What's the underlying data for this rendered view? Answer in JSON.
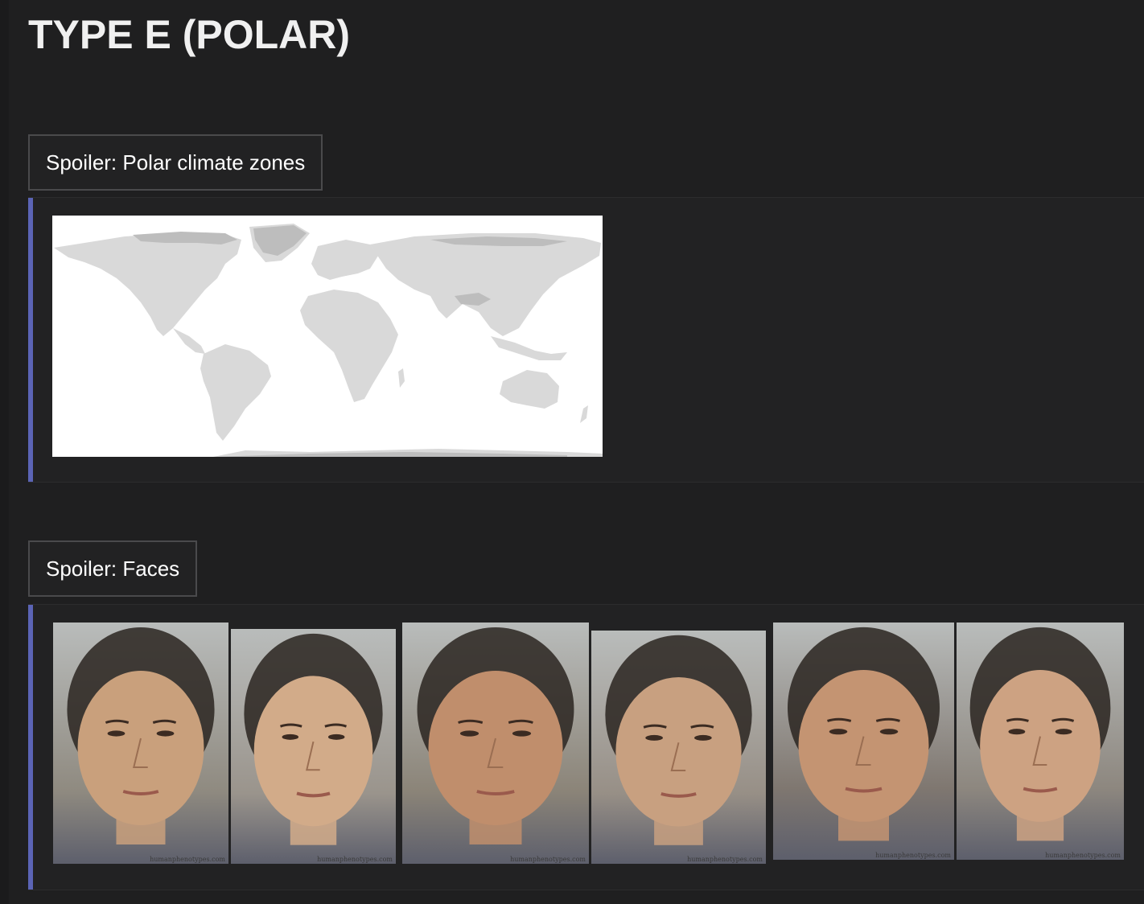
{
  "page": {
    "title": "TYPE E (POLAR)"
  },
  "spoilers": [
    {
      "label": "Spoiler: Polar climate zones",
      "content": "world map"
    },
    {
      "label": "Spoiler: Faces",
      "content": "face composites",
      "watermark": "humanphenotypes.com",
      "faces": [
        {
          "sex": "male"
        },
        {
          "sex": "female"
        },
        {
          "sex": "male"
        },
        {
          "sex": "female"
        },
        {
          "sex": "male"
        },
        {
          "sex": "female"
        }
      ]
    }
  ],
  "colors": {
    "background": "#1f1f20",
    "accent": "#5b64b5",
    "border": "#4a4a4c"
  }
}
